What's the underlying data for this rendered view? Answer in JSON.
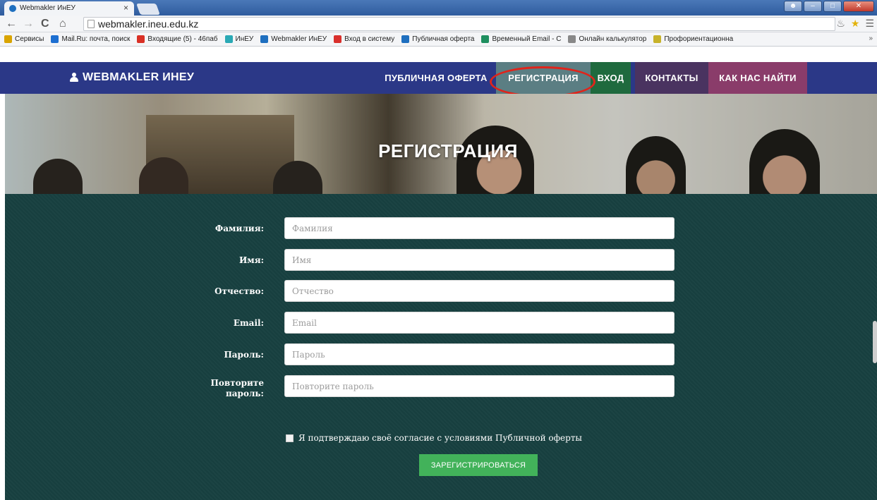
{
  "browser": {
    "tab_title": "Webmakler ИнЕУ",
    "tab_close": "×",
    "url": "webmakler.ineu.edu.kz",
    "bookmarks": [
      {
        "label": "Сервисы",
        "color": "#d9a400"
      },
      {
        "label": "Mail.Ru: почта, поиск",
        "color": "#1d6fd1"
      },
      {
        "label": "Входящие (5) - 46паб",
        "color": "#d93025"
      },
      {
        "label": "ИнЕУ",
        "color": "#2aa9b5"
      },
      {
        "label": "Webmakler ИнЕУ",
        "color": "#1e6fbf"
      },
      {
        "label": "Вход в систему",
        "color": "#d9302c"
      },
      {
        "label": "Публичная оферта",
        "color": "#1e6fbf"
      },
      {
        "label": "Временный Email - С",
        "color": "#1f8f5f"
      },
      {
        "label": "Онлайн калькулятор",
        "color": "#888888"
      },
      {
        "label": "Профориентационна",
        "color": "#c7b22a"
      }
    ],
    "bookmarks_more": "»"
  },
  "site": {
    "brand": "WEBMAKLER ИНЕУ",
    "nav": {
      "offer": "ПУБЛИЧНАЯ ОФЕРТА",
      "register": "РЕГИСТРАЦИЯ",
      "login": "ВХОД",
      "contacts": "КОНТАКТЫ",
      "find_us": "КАК НАС НАЙТИ"
    },
    "hero_title": "РЕГИСТРАЦИЯ"
  },
  "form": {
    "fields": [
      {
        "label": "Фамилия:",
        "placeholder": "Фамилия",
        "value": ""
      },
      {
        "label": "Имя:",
        "placeholder": "Имя",
        "value": ""
      },
      {
        "label": "Отчество:",
        "placeholder": "Отчество",
        "value": ""
      },
      {
        "label": "Email:",
        "placeholder": "Email",
        "value": ""
      },
      {
        "label": "Пароль:",
        "placeholder": "Пароль",
        "value": ""
      },
      {
        "label": "Повторите пароль:",
        "placeholder": "Повторите пароль",
        "value": ""
      }
    ],
    "consent": "Я подтверждаю своё согласие с условиями Публичной оферты",
    "consent_checked": false,
    "submit": "ЗАРЕГИСТРИРОВАТЬСЯ"
  },
  "colors": {
    "nav_bg": "#2b3887",
    "form_bg": "#173f3f",
    "submit_bg": "#42b25a",
    "highlight": "#e0241b"
  }
}
